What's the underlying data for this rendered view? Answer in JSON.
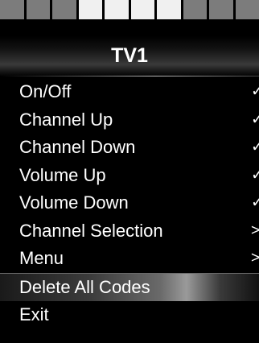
{
  "tabs": [
    {
      "state": "inactive"
    },
    {
      "state": "inactive"
    },
    {
      "state": "inactive"
    },
    {
      "state": "active"
    },
    {
      "state": "active"
    },
    {
      "state": "active"
    },
    {
      "state": "active"
    },
    {
      "state": "inactive"
    },
    {
      "state": "inactive"
    },
    {
      "state": "inactive"
    }
  ],
  "header": {
    "title": "TV1"
  },
  "menu": {
    "items": [
      {
        "label": "On/Off",
        "mark": "✓"
      },
      {
        "label": "Channel Up",
        "mark": "✓"
      },
      {
        "label": "Channel Down",
        "mark": "✓"
      },
      {
        "label": "Volume Up",
        "mark": "✓"
      },
      {
        "label": "Volume Down",
        "mark": "✓"
      },
      {
        "label": "Channel Selection",
        "mark": ">"
      },
      {
        "label": "Menu",
        "mark": ">"
      },
      {
        "label": "Delete All Codes",
        "mark": ""
      },
      {
        "label": "Exit",
        "mark": ""
      }
    ],
    "selected_index": 7
  },
  "colors": {
    "background": "#000000",
    "tab_inactive": "#7c7c7c",
    "tab_active": "#f0f0f0",
    "text": "#ffffff"
  }
}
